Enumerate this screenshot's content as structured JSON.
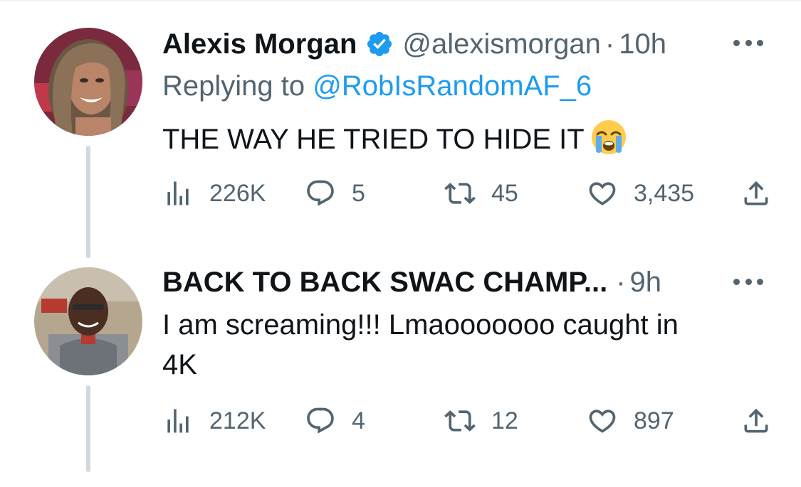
{
  "tweets": [
    {
      "name": "Alexis Morgan",
      "verified": true,
      "handle": "@alexismorgan",
      "separator": "·",
      "time": "10h",
      "replying_prefix": "Replying to ",
      "replying_handle": "@RobIsRandomAF_6",
      "text": "THE WAY HE TRIED TO HIDE IT",
      "emoji": "loudly-crying-face",
      "stats": {
        "views": "226K",
        "replies": "5",
        "retweets": "45",
        "likes": "3,435"
      }
    },
    {
      "name": "BACK TO BACK SWAC CHAMP...",
      "verified": false,
      "handle": "",
      "separator": "·",
      "time": "9h",
      "text_line1": "I am screaming!!! Lmaooooooo caught in",
      "text_line2": "4K",
      "stats": {
        "views": "212K",
        "replies": "4",
        "retweets": "12",
        "likes": "897"
      }
    }
  ],
  "colors": {
    "text": "#0f1419",
    "secondary": "#536471",
    "link": "#1d9bf0",
    "thread_line": "#cfd9de",
    "emoji": "#ffcc4d"
  }
}
